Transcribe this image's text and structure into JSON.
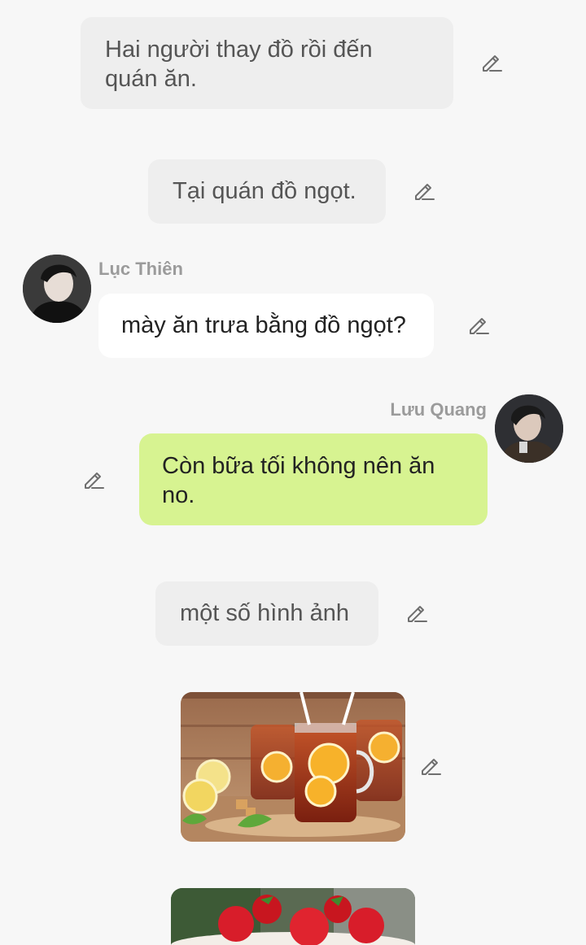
{
  "messages": [
    {
      "type": "narration",
      "text": "Hai người thay đồ rồi đến quán ăn."
    },
    {
      "type": "narration",
      "text": "Tại quán đồ ngọt."
    },
    {
      "type": "incoming",
      "sender": "Lục Thiên",
      "text": "mày ăn trưa bằng đồ ngọt?"
    },
    {
      "type": "outgoing",
      "sender": "Lưu Quang",
      "text": "Còn bữa tối không nên ăn no."
    },
    {
      "type": "narration",
      "text": "một số hình ảnh"
    },
    {
      "type": "image",
      "subject": "iced lemon tea jars"
    },
    {
      "type": "image",
      "subject": "strawberry dessert"
    }
  ],
  "icons": {
    "edit": "pencil-edit-icon"
  },
  "colors": {
    "background": "#f7f7f7",
    "narration_bubble": "#eeeeee",
    "incoming_bubble": "#ffffff",
    "outgoing_bubble": "#d7f391",
    "sender_name": "#9b9b9b"
  }
}
